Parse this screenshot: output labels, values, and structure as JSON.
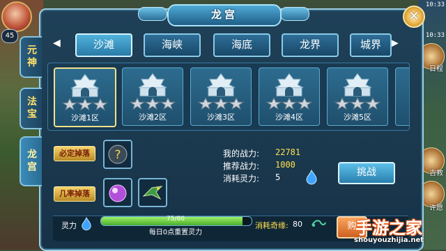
{
  "hud": {
    "level": "45",
    "clock_top": "10:33",
    "clock_second": "10:33",
    "right_labels": [
      "日程",
      "吉救",
      "许愿"
    ]
  },
  "dialog": {
    "title": "龙宫",
    "close_icon": "close-icon"
  },
  "side_tabs": [
    {
      "label": "元神",
      "active": false
    },
    {
      "label": "法宝",
      "active": false
    },
    {
      "label": "龙宫",
      "active": true
    }
  ],
  "zone_tabs": [
    {
      "label": "沙滩",
      "active": true
    },
    {
      "label": "海峡",
      "active": false
    },
    {
      "label": "海底",
      "active": false
    },
    {
      "label": "龙界",
      "active": false
    },
    {
      "label": "城界",
      "active": false
    }
  ],
  "areas": [
    {
      "label": "沙滩1区",
      "active": true,
      "stars": 3
    },
    {
      "label": "沙滩2区",
      "active": false,
      "stars": 3
    },
    {
      "label": "沙滩3区",
      "active": false,
      "stars": 3
    },
    {
      "label": "沙滩4区",
      "active": false,
      "stars": 3
    },
    {
      "label": "沙滩5区",
      "active": false,
      "stars": 3
    }
  ],
  "drops": {
    "guaranteed_label": "必定掉落",
    "chance_label": "几率掉落"
  },
  "stats": {
    "my_power_label": "我的战力:",
    "my_power": "22781",
    "recommended_label": "推荐战力:",
    "recommended": "1000",
    "cost_label": "消耗灵力:",
    "cost": "5"
  },
  "challenge_label": "挑战",
  "bottom": {
    "spirit_label": "灵力",
    "progress_text": "75/80",
    "progress_fraction": 0.9375,
    "reset_note": "每日0点重置灵力",
    "consume_label": "消耗奇缘:",
    "consume_value": "80",
    "action_label": "购"
  },
  "watermark": {
    "main": "手游之家",
    "sub": "shouyouzhijia.net"
  },
  "colors": {
    "panel": "#1f4158",
    "accent": "#9fd0e6",
    "stat_value": "#ffe24d",
    "progress": "#7ad54a"
  }
}
